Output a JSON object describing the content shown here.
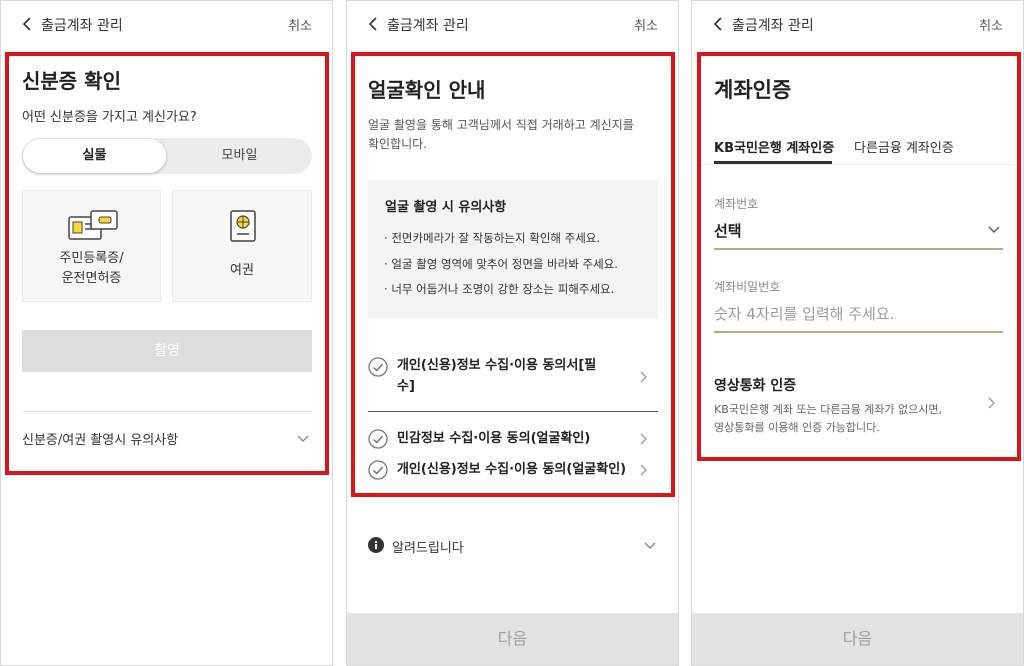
{
  "panels": [
    {
      "topbar": {
        "title": "출금계좌 관리",
        "cancel": "취소"
      },
      "heading": "신분증 확인",
      "question": "어떤 신분증을 가지고 계신가요?",
      "segment": {
        "active": "실물",
        "inactive": "모바일"
      },
      "cards": [
        {
          "line1": "주민등록증/",
          "line2": "운전면허증",
          "icon": "id-card-icon"
        },
        {
          "line1": "여권",
          "icon": "passport-icon"
        }
      ],
      "capture_button": "촬영",
      "caution_row": "신분증/여권 촬영시 유의사항"
    },
    {
      "topbar": {
        "title": "출금계좌 관리",
        "cancel": "취소"
      },
      "heading": "얼굴확인 안내",
      "desc_line1": "얼굴 촬영을 통해 고객님께서 직접 거래하고 계신지를",
      "desc_line2": "확인합니다.",
      "notice": {
        "title": "얼굴 촬영 시 유의사항",
        "items": [
          "전면카메라가 잘 작동하는지 확인해 주세요.",
          "얼굴 촬영 영역에 맞추어 정면을 바라봐 주세요.",
          "너무 어둡거나 조명이 강한 장소는 피해주세요."
        ]
      },
      "agreements": [
        {
          "line1": "개인(신용)정보 수집·이용 동의서[필",
          "line2": "수]"
        },
        {
          "line1": "민감정보 수집·이용 동의(얼굴확인)"
        },
        {
          "line1": "개인(신용)정보 수집·이용 동의(얼굴확인)"
        }
      ],
      "info_row": "알려드립니다",
      "next_button": "다음"
    },
    {
      "topbar": {
        "title": "출금계좌 관리",
        "cancel": "취소"
      },
      "heading": "계좌인증",
      "tabs": {
        "active": "KB국민은행 계좌인증",
        "inactive": "다른금융 계좌인증"
      },
      "account_number": {
        "label": "계좌번호",
        "value": "선택"
      },
      "account_password": {
        "label": "계좌비밀번호",
        "placeholder": "숫자 4자리를 입력해 주세요."
      },
      "video_call": {
        "title": "영상통화 인증",
        "desc_line1": "KB국민은행 계좌 또는 다른금융 계좌가 없으시면,",
        "desc_line2": "영상통화를 이용해 인증 가능합니다."
      },
      "next_button": "다음"
    }
  ],
  "colors": {
    "highlight_frame": "#d7151a",
    "notice_underline": "#fbd83a",
    "field_underline": "#b9a889"
  }
}
